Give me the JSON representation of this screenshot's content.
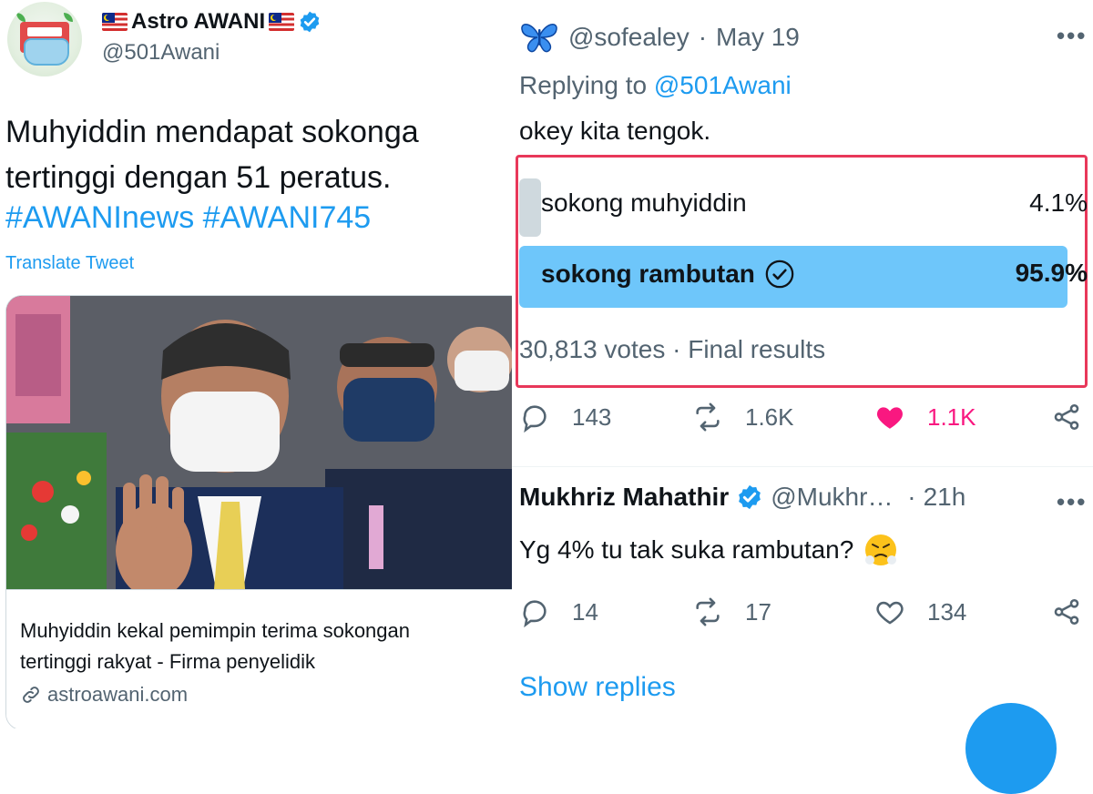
{
  "left_tweet": {
    "display_name": "Astro AWANI",
    "handle": "@501Awani",
    "text": "Muhyiddin mendapat sokonga\ntertinggi dengan 51 peratus.",
    "hashtags": "#AWANInews #AWANI745",
    "translate_label": "Translate Tweet",
    "card": {
      "title": "Muhyiddin kekal pemimpin terima sokongan\ntertinggi rakyat - Firma penyelidik",
      "domain": "astroawani.com"
    }
  },
  "reply_tweet": {
    "handle": "@sofealey",
    "date": "May 19",
    "replying_prefix": "Replying to",
    "replying_to": "@501Awani",
    "text": "okey kita tengok.",
    "poll": {
      "options": [
        {
          "label": "sokong muhyiddin",
          "percent": "4.1%",
          "share": 0.041,
          "winner": false
        },
        {
          "label": "sokong rambutan",
          "percent": "95.9%",
          "share": 0.959,
          "winner": true
        }
      ],
      "votes": "30,813 votes",
      "status": "Final results"
    },
    "actions": {
      "replies": "143",
      "retweets": "1.6K",
      "likes": "1.1K"
    }
  },
  "second_reply": {
    "name": "Mukhriz Mahathir",
    "handle": "@Mukhr…",
    "time": "21h",
    "text": "Yg 4% tu tak suka rambutan?",
    "actions": {
      "replies": "14",
      "retweets": "17",
      "likes": "134"
    }
  },
  "show_replies": "Show replies",
  "colors": {
    "accent": "#1d9bf0",
    "like": "#f91880",
    "poll_highlight": "#e8385a"
  }
}
